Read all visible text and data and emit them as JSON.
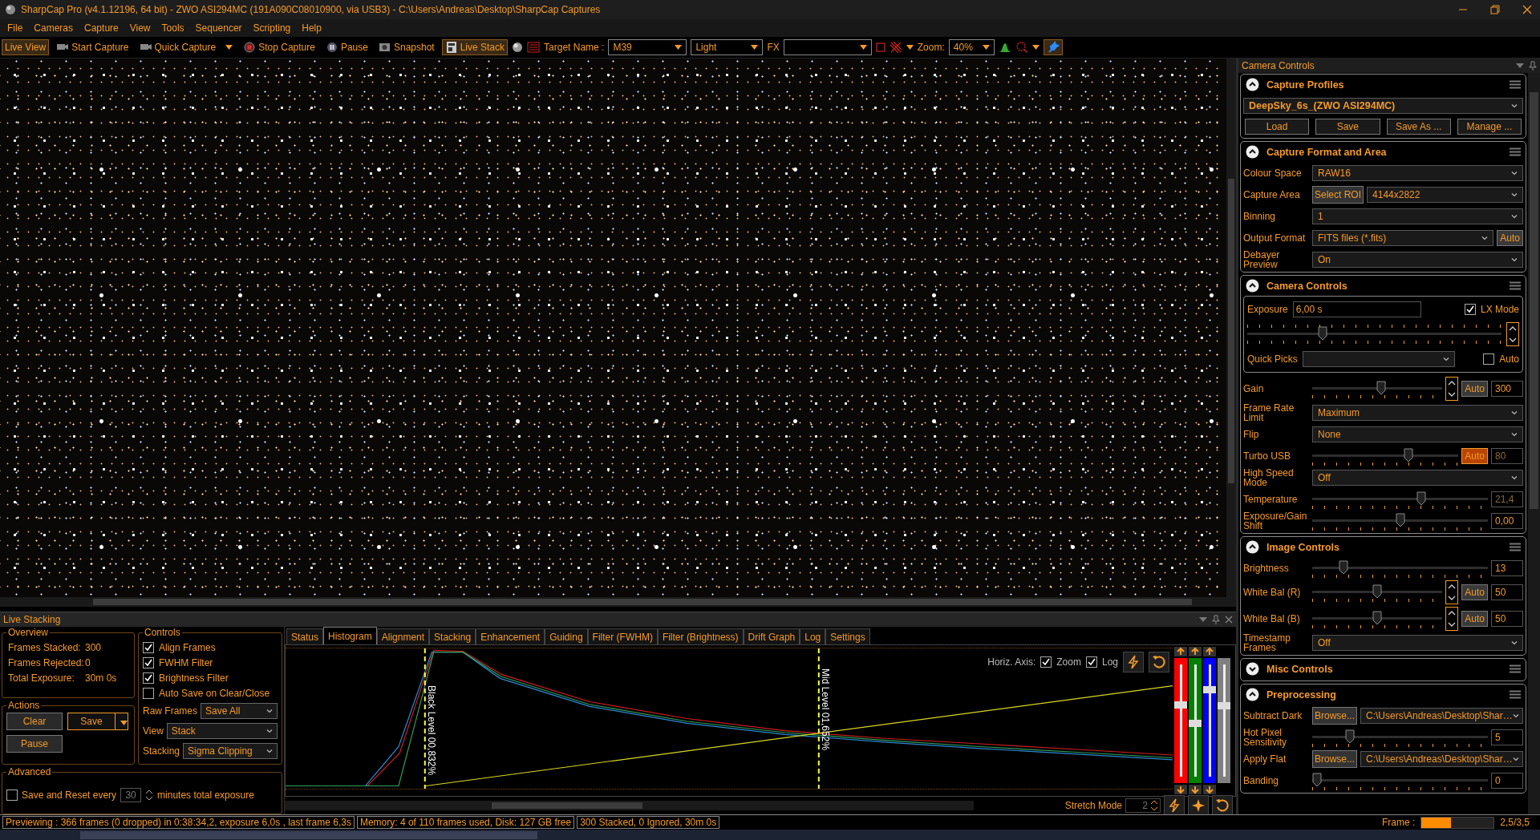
{
  "window": {
    "title": "SharpCap Pro (v4.1.12196, 64 bit) - ZWO ASI294MC (191A090C08010900, via USB3) - C:\\Users\\Andreas\\Desktop\\SharpCap Captures"
  },
  "menu": [
    "File",
    "Cameras",
    "Capture",
    "View",
    "Tools",
    "Sequencer",
    "Scripting",
    "Help"
  ],
  "toolbar": {
    "buttons": [
      {
        "kind": "text",
        "label": "Live View",
        "selected": true
      },
      {
        "kind": "icon-text",
        "label": "Start Capture",
        "selected": false
      },
      {
        "kind": "menu",
        "label": "Quick Capture",
        "selected": false
      },
      {
        "kind": "icon-text",
        "label": "Stop Capture",
        "selected": false
      },
      {
        "kind": "icon-text",
        "label": "Pause",
        "selected": false
      },
      {
        "kind": "icon-text",
        "label": "Snapshot",
        "selected": false
      },
      {
        "kind": "icon-text",
        "label": "Live Stack",
        "selected": true
      }
    ],
    "target_label": "Target Name :",
    "target": "M39",
    "frame_type": "Light",
    "fx_label": "FX",
    "zoom_label": "Zoom:",
    "zoom": "40%",
    "connect": {
      "selected": true
    }
  },
  "camera_controls": {
    "title": "Camera Controls",
    "sections": [
      {
        "title": "Capture Profiles",
        "expanded": true,
        "rows": [
          {
            "kind": "profile",
            "value": "DeepSky_6s_(ZWO ASI294MC)",
            "buttons": [
              "Load",
              "Save",
              "Save As ...",
              "Manage ..."
            ]
          }
        ]
      },
      {
        "title": "Capture Format and Area",
        "expanded": true,
        "rows": [
          {
            "kind": "select",
            "label": "Colour Space",
            "value": "RAW16"
          },
          {
            "kind": "select-button",
            "label": "Capture Area",
            "button": "Select ROI",
            "value": "4144x2822"
          },
          {
            "kind": "select",
            "label": "Binning",
            "value": "1"
          },
          {
            "kind": "select-auto",
            "label": "Output Format",
            "value": "FITS files (*.fits)",
            "auto": {
              "label": "Auto",
              "on": false
            }
          },
          {
            "kind": "select",
            "label": "Debayer Preview",
            "value": "On"
          }
        ]
      },
      {
        "title": "Camera Controls",
        "expanded": true,
        "rows": [
          {
            "kind": "exposure",
            "label": "Exposure",
            "value": "6,00 s",
            "lx": {
              "label": "LX Mode",
              "checked": true
            },
            "level": 0.29,
            "quick_picks": {
              "label": "Quick Picks",
              "auto": {
                "label": "Auto",
                "checked": false
              }
            }
          },
          {
            "kind": "slider",
            "label": "Gain",
            "level": 0.53,
            "spinner": true,
            "auto": {
              "label": "Auto",
              "on": false
            },
            "value": "300",
            "disabled": false
          },
          {
            "kind": "select",
            "label": "Frame Rate Limit",
            "value": "Maximum"
          },
          {
            "kind": "select",
            "label": "Flip",
            "value": "None"
          },
          {
            "kind": "slider",
            "label": "Turbo USB",
            "level": 0.67,
            "spinner": false,
            "auto": {
              "label": "Auto",
              "on": true
            },
            "value": "80",
            "disabled": true
          },
          {
            "kind": "select",
            "label": "High Speed Mode",
            "value": "Off"
          },
          {
            "kind": "slider",
            "label": "Temperature",
            "level": 0.63,
            "spinner": false,
            "value": "21,4",
            "disabled": true
          },
          {
            "kind": "slider",
            "label": "Exposure/Gain Shift",
            "level": 0.5,
            "spinner": false,
            "value": "0,00",
            "disabled": false
          }
        ]
      },
      {
        "title": "Image Controls",
        "expanded": true,
        "rows": [
          {
            "kind": "slider",
            "label": "Brightness",
            "level": 0.16,
            "spinner": false,
            "value": "13",
            "disabled": false
          },
          {
            "kind": "slider",
            "label": "White Bal (R)",
            "level": 0.5,
            "spinner": true,
            "auto": {
              "label": "Auto",
              "on": false
            },
            "value": "50",
            "disabled": false
          },
          {
            "kind": "slider",
            "label": "White Bal (B)",
            "level": 0.5,
            "spinner": true,
            "auto": {
              "label": "Auto",
              "on": false
            },
            "value": "50",
            "disabled": false
          },
          {
            "kind": "select",
            "label": "Timestamp Frames",
            "value": "Off"
          }
        ]
      },
      {
        "title": "Misc Controls",
        "expanded": false
      },
      {
        "title": "Preprocessing",
        "expanded": true,
        "rows": [
          {
            "kind": "select-button",
            "label": "Subtract Dark",
            "button": "Browse...",
            "value": "C:\\Users\\Andreas\\Desktop\\Shar…"
          },
          {
            "kind": "slider",
            "label": "Hot Pixel Sensitivity",
            "level": 0.2,
            "spinner": false,
            "value": "5",
            "disabled": false
          },
          {
            "kind": "select-button",
            "label": "Apply Flat",
            "button": "Browse...",
            "value": "C:\\Users\\Andreas\\Desktop\\Shar…"
          },
          {
            "kind": "slider",
            "label": "Banding",
            "level": 0,
            "spinner": false,
            "value": "0",
            "disabled": false
          }
        ]
      }
    ]
  },
  "live_stacking": {
    "title": "Live Stacking",
    "overview": {
      "title": "Overview",
      "lines": [
        {
          "label": "Frames Stacked:",
          "value": "300"
        },
        {
          "label": "Frames Rejected:",
          "value": "0"
        },
        {
          "label": "Total Exposure:",
          "value": "30m 0s"
        }
      ]
    },
    "actions": {
      "title": "Actions",
      "buttons": [
        "Clear",
        "Save",
        "Pause"
      ]
    },
    "controls": {
      "title": "Controls",
      "checks": [
        {
          "label": "Align Frames",
          "checked": true
        },
        {
          "label": "FWHM Filter",
          "checked": true
        },
        {
          "label": "Brightness Filter",
          "checked": true
        },
        {
          "label": "Auto Save on Clear/Close",
          "checked": false
        }
      ],
      "selects": [
        {
          "label": "Raw Frames",
          "value": "Save All"
        },
        {
          "label": "View",
          "value": "Stack"
        },
        {
          "label": "Stacking",
          "value": "Sigma Clipping"
        }
      ]
    },
    "advanced": {
      "title": "Advanced",
      "checked": false,
      "label": "Save and Reset every",
      "value": "30",
      "suffix": "minutes total exposure"
    },
    "tabs": [
      {
        "label": "Status",
        "selected": false
      },
      {
        "label": "Histogram",
        "selected": true
      },
      {
        "label": "Alignment",
        "selected": false
      },
      {
        "label": "Stacking",
        "selected": false
      },
      {
        "label": "Enhancement",
        "selected": false
      },
      {
        "label": "Guiding",
        "selected": false
      },
      {
        "label": "Filter (FWHM)",
        "selected": false
      },
      {
        "label": "Filter (Brightness)",
        "selected": false
      },
      {
        "label": "Drift Graph",
        "selected": false
      },
      {
        "label": "Log",
        "selected": false
      },
      {
        "label": "Settings",
        "selected": false
      }
    ],
    "histogram": {
      "black_level": "Black Level  00,832%",
      "mid_level": "Mid Level  01,652%",
      "axis_label": "Horiz. Axis:",
      "zoom": {
        "label": "Zoom",
        "checked": true
      },
      "log": {
        "label": "Log",
        "checked": true
      },
      "channel_sliders": [
        {
          "color": "#ff0000",
          "level": 0.63
        },
        {
          "color": "#008000",
          "level": 0.48
        },
        {
          "color": "#0000ff",
          "level": 0.75
        },
        {
          "color": "#808080",
          "level": 0.62
        }
      ],
      "stretch_label": "Stretch Mode",
      "stretch_value": "2"
    }
  },
  "status_bar": {
    "segments": [
      "Previewing : 366 frames (0 dropped) in 0:38:34,2, exposure 6,0s , last frame 6,3s",
      "Memory: 4 of 110 frames used, Disk: 127 GB free",
      "300 Stacked, 0 Ignored, 30m 0s"
    ],
    "frame": {
      "label": "Frame :",
      "level": 0.41,
      "reading": "2,5/3,5"
    }
  }
}
